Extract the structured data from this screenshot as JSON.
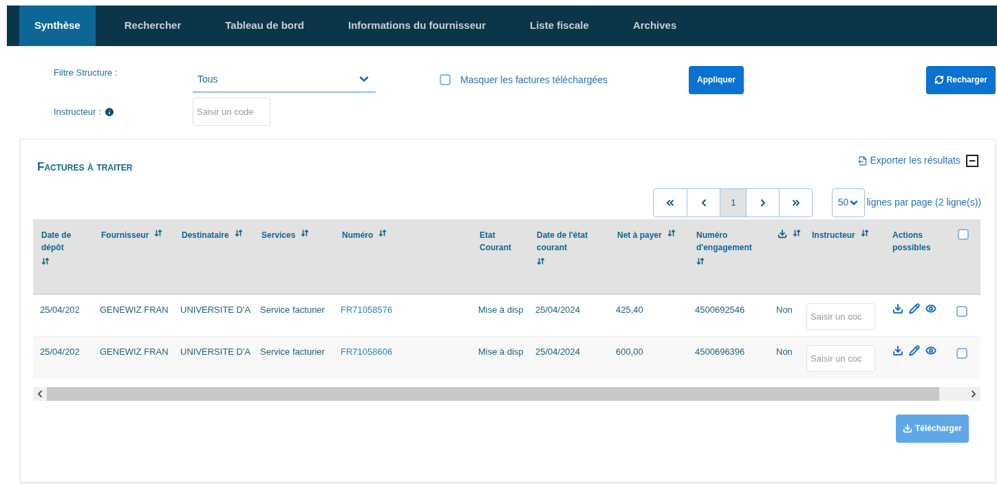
{
  "tabs": [
    {
      "label": "Synthèse",
      "selected": true
    },
    {
      "label": "Rechercher",
      "selected": false
    },
    {
      "label": "Tableau de bord",
      "selected": false
    },
    {
      "label": "Informations du fournisseur",
      "selected": false
    },
    {
      "label": "Liste fiscale",
      "selected": false
    },
    {
      "label": "Archives",
      "selected": false
    }
  ],
  "filters": {
    "structure_label": "Filtre Structure :",
    "structure_value": "Tous",
    "hide_label": "Masquer les factures téléchargées",
    "hide_checked": false,
    "apply_button": "Appliquer",
    "reload_button": "Recharger",
    "instructor_label": "Instructeur :",
    "instructor_placeholder": "Saisir un code"
  },
  "panel": {
    "title": "Factures à traiter",
    "export_link": "Exporter les résultats",
    "pagination": [
      {
        "kind": "first",
        "selected": false
      },
      {
        "kind": "prev",
        "selected": false
      },
      {
        "kind": "page",
        "label": "1",
        "selected": true
      },
      {
        "kind": "next",
        "selected": false
      },
      {
        "kind": "last",
        "selected": false
      }
    ],
    "per_page_value": "50",
    "per_page_text": "lignes par page (2 ligne(s))",
    "columns": [
      {
        "kind": "text",
        "label": "Date de dépôt",
        "sortable": true
      },
      {
        "kind": "text",
        "label": "Fournisseur",
        "sortable": true
      },
      {
        "kind": "text",
        "label": "Destinataire",
        "sortable": true
      },
      {
        "kind": "text",
        "label": "Services",
        "sortable": true
      },
      {
        "kind": "link",
        "label": "Numéro",
        "sortable": true
      },
      {
        "kind": "text",
        "label": "Etat Courant",
        "sortable": false
      },
      {
        "kind": "text",
        "label": "Date de l'état courant",
        "sortable": true
      },
      {
        "kind": "text",
        "label": "Net à payer",
        "sortable": true
      },
      {
        "kind": "text",
        "label": "Numéro d'engagement",
        "sortable": true
      },
      {
        "kind": "download",
        "sortable": true
      },
      {
        "kind": "input",
        "label": "Instructeur",
        "sortable": true
      },
      {
        "kind": "actions",
        "label": "Actions possibles",
        "sortable": false
      },
      {
        "kind": "checkbox",
        "checked": false
      }
    ],
    "rows": [
      {
        "cells": [
          "25/04/202",
          "GENEWIZ FRAN",
          "UNIVERSITE D'A",
          "Service facturier",
          "FR71058576",
          "Mise à disp",
          "25/04/2024",
          "425,40",
          "4500692546",
          "Non"
        ],
        "placeholder": "Saisir un coc",
        "checked": false
      },
      {
        "cells": [
          "25/04/202",
          "GENEWIZ FRAN",
          "UNIVERSITE D'A",
          "Service facturier",
          "FR71058606",
          "Mise à disp",
          "25/04/2024",
          "600,00",
          "4500696396",
          "Non"
        ],
        "placeholder": "Saisir un coc",
        "checked": false
      }
    ],
    "download_button": {
      "label": "Télécharger",
      "disabled": true
    }
  }
}
